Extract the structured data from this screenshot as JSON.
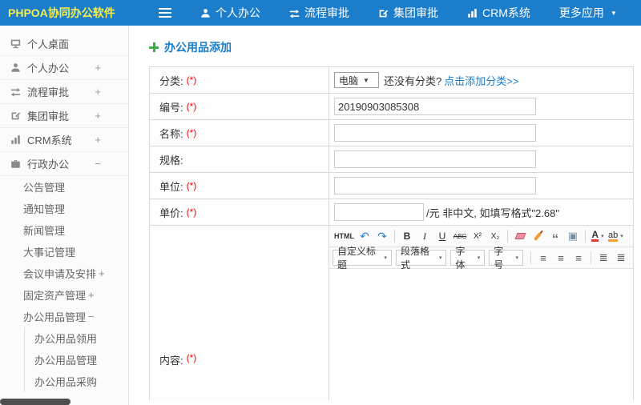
{
  "topbar": {
    "logo": "PHPOA协同办公软件",
    "nav": [
      {
        "label": "个人办公"
      },
      {
        "label": "流程审批"
      },
      {
        "label": "集团审批"
      },
      {
        "label": "CRM系统"
      },
      {
        "label": "更多应用"
      }
    ]
  },
  "sidebar": {
    "items": [
      {
        "label": "个人桌面",
        "expand": ""
      },
      {
        "label": "个人办公",
        "expand": "+"
      },
      {
        "label": "流程审批",
        "expand": "+"
      },
      {
        "label": "集团审批",
        "expand": "+"
      },
      {
        "label": "CRM系统",
        "expand": "+"
      },
      {
        "label": "行政办公",
        "expand": "−"
      }
    ],
    "admin_children": [
      {
        "label": "公告管理",
        "expand": ""
      },
      {
        "label": "通知管理",
        "expand": ""
      },
      {
        "label": "新闻管理",
        "expand": ""
      },
      {
        "label": "大事记管理",
        "expand": ""
      },
      {
        "label": "会议申请及安排",
        "expand": "+"
      },
      {
        "label": "固定资产管理",
        "expand": "+"
      },
      {
        "label": "办公用品管理",
        "expand": "−"
      }
    ],
    "supplies_children": [
      {
        "label": "办公用品领用"
      },
      {
        "label": "办公用品管理"
      },
      {
        "label": "办公用品采购"
      }
    ]
  },
  "main": {
    "title": "办公用品添加",
    "form": {
      "category": {
        "label": "分类:",
        "required": "(*)",
        "value": "电脑",
        "hint": "还没有分类?",
        "link": "点击添加分类>>"
      },
      "code": {
        "label": "编号:",
        "required": "(*)",
        "value": "20190903085308"
      },
      "name": {
        "label": "名称:",
        "required": "(*)",
        "value": ""
      },
      "spec": {
        "label": "规格:",
        "required": "",
        "value": ""
      },
      "unit": {
        "label": "单位:",
        "required": "(*)",
        "value": ""
      },
      "price": {
        "label": "单价:",
        "required": "(*)",
        "value": "",
        "suffix": "/元 非中文, 如填写格式\"2.68\""
      },
      "content": {
        "label": "内容:",
        "required": "(*)"
      }
    },
    "editor": {
      "html": "HTML",
      "bold": "B",
      "italic": "I",
      "underline": "U",
      "strike": "ABC",
      "sup": "X²",
      "sub": "X₂",
      "heading": "自定义标题",
      "paragraph": "段落格式",
      "font": "字体",
      "size": "字号",
      "color_letter": "A",
      "highlight_letters": "ab"
    }
  },
  "icons": {
    "undo": "↶",
    "redo": "↷",
    "quote": "“",
    "image": "▣",
    "caret": "▾",
    "select_arrow": "▼",
    "align": "≡",
    "list": "≣"
  },
  "colors": {
    "topbar_blue": "#1c7ecb",
    "accent_blue": "#1a7dc9",
    "logo_yellow": "#f5ee4f",
    "required_red": "#ff0000",
    "plus_green": "#3fae49"
  }
}
